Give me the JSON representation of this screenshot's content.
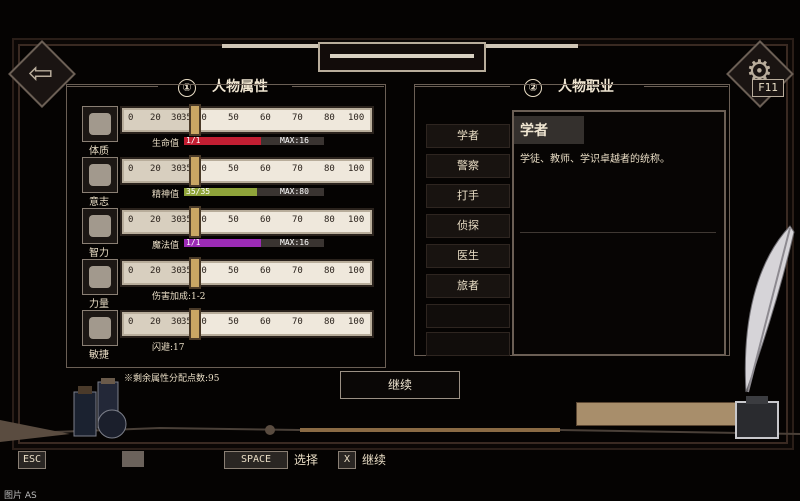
{
  "attributes": {
    "number": "①",
    "title": "人物属性",
    "ruler_ticks": [
      "0",
      "20",
      "30",
      "35",
      "40",
      "50",
      "60",
      "70",
      "80",
      "100"
    ],
    "stats": [
      {
        "name": "体质",
        "icon": "body-icon",
        "value_pct": 0.28,
        "bar": {
          "label": "生命值",
          "value": "1/1",
          "max": "MAX:16",
          "fill": 0.55,
          "color": "#c21e32"
        }
      },
      {
        "name": "意志",
        "icon": "will-icon",
        "value_pct": 0.28,
        "bar": {
          "label": "精神值",
          "value": "35/35",
          "max": "MAX:80",
          "fill": 0.52,
          "color": "#8fa33a"
        }
      },
      {
        "name": "智力",
        "icon": "intellect-icon",
        "value_pct": 0.28,
        "bar": {
          "label": "魔法值",
          "value": "1/1",
          "max": "MAX:16",
          "fill": 0.55,
          "color": "#9b2bb5"
        }
      },
      {
        "name": "力量",
        "icon": "strength-icon",
        "value_pct": 0.28,
        "text": "伤害加成:1-2"
      },
      {
        "name": "敏捷",
        "icon": "agility-icon",
        "value_pct": 0.28,
        "text": "闪避:17"
      }
    ],
    "remaining": "※剩余属性分配点数:95"
  },
  "classes": {
    "number": "②",
    "title": "人物职业",
    "items": [
      "学者",
      "警察",
      "打手",
      "侦探",
      "医生",
      "旅者"
    ],
    "selected": {
      "name": "学者",
      "description": "学徒、教师、学识卓越者的统称。"
    }
  },
  "continue_label": "继续",
  "f11_label": "F11",
  "hints": {
    "esc": "ESC",
    "space": "SPACE",
    "select": "选择",
    "continue": "继续",
    "x": "X"
  },
  "watermark": "图片 AS",
  "colors": {
    "accent": "#c9a664",
    "frame": "#6b5f55"
  }
}
